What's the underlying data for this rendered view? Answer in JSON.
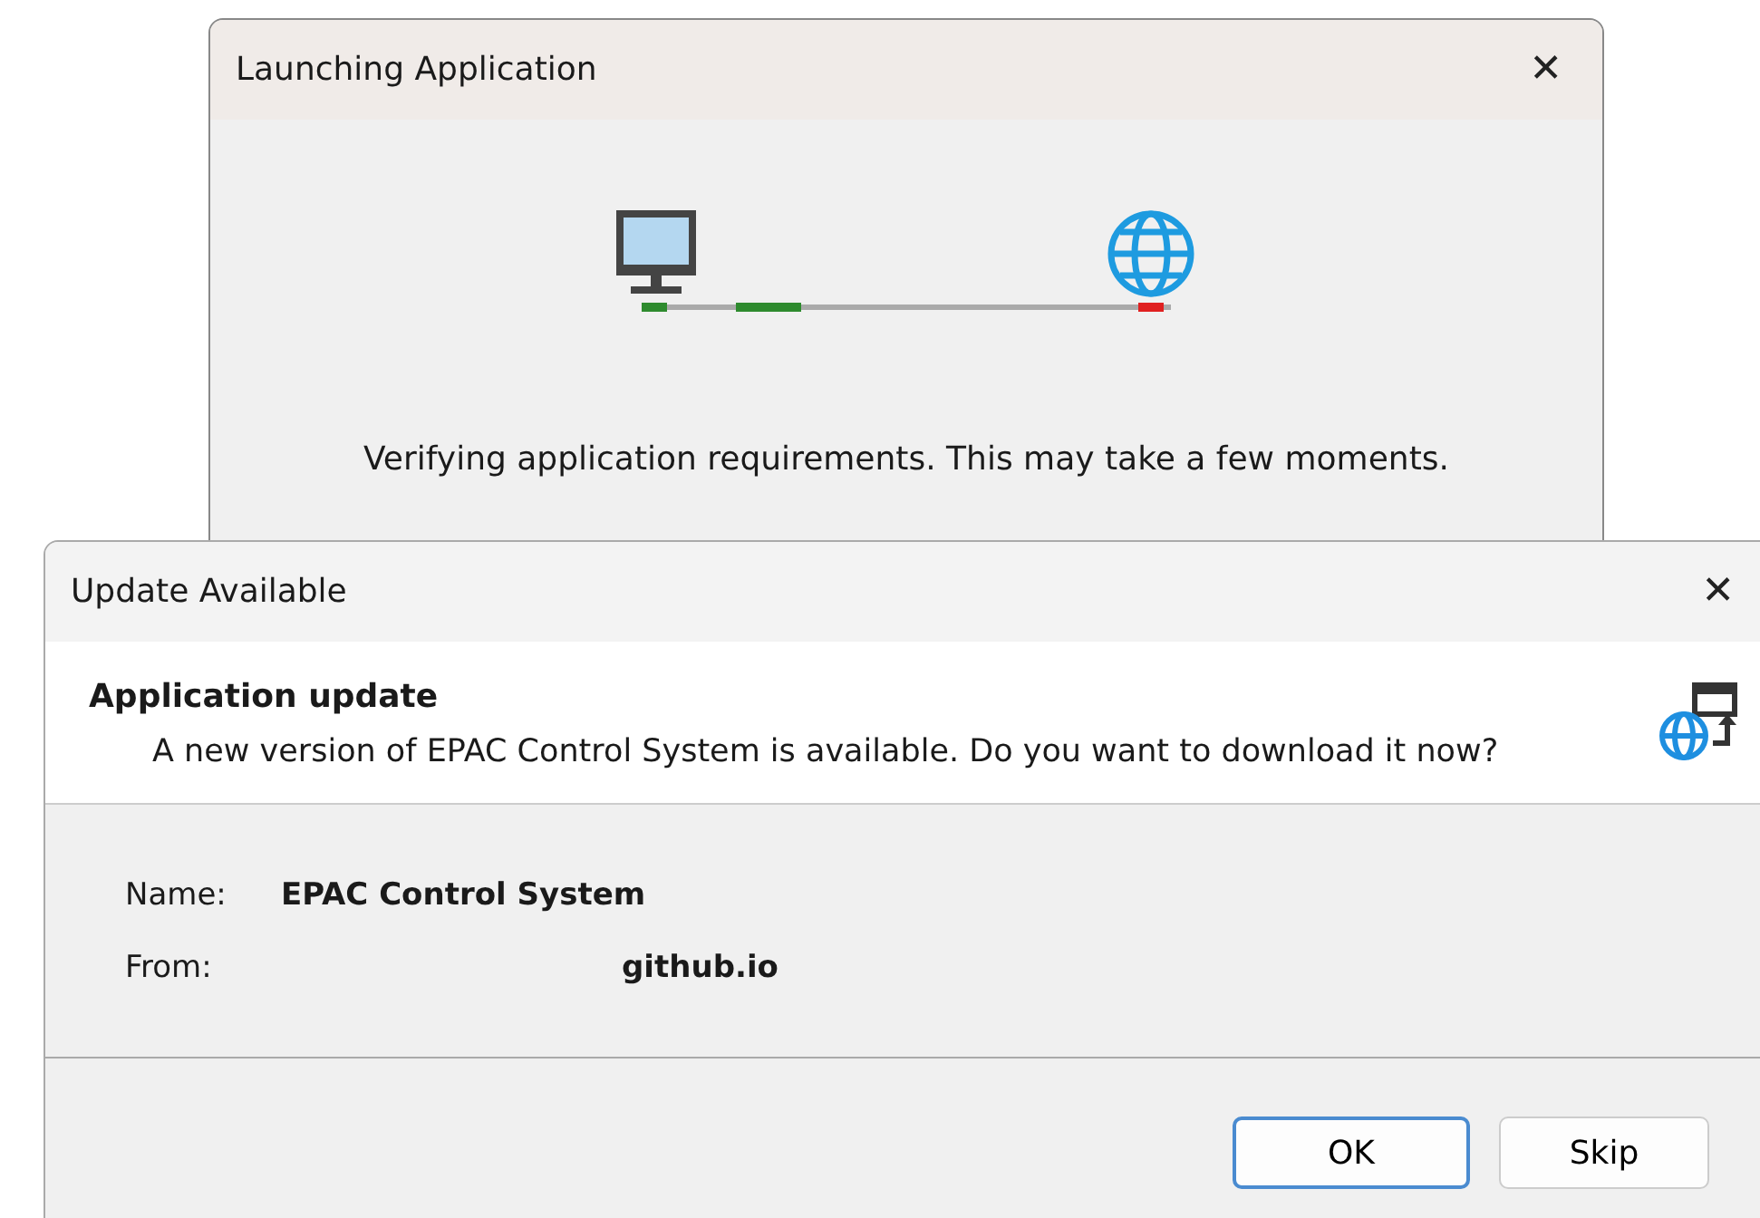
{
  "launch_dialog": {
    "title": "Launching Application",
    "close": "✕",
    "message": "Verifying application requirements. This may take a few moments."
  },
  "update_dialog": {
    "title": "Update Available",
    "close": "✕",
    "heading": "Application update",
    "description": "A new version of EPAC Control System is available. Do you want to download it now?",
    "fields": [
      {
        "label": "Name:",
        "value": "EPAC Control System"
      },
      {
        "label": "From:",
        "value": "github.io"
      }
    ],
    "buttons": [
      {
        "label": "OK",
        "default": true
      },
      {
        "label": "Skip",
        "default": false
      }
    ]
  }
}
